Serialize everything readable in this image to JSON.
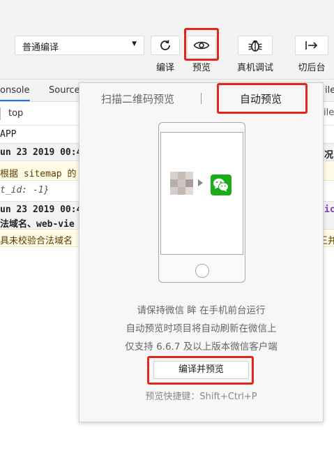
{
  "toolbar": {
    "compile_mode": "普通编译",
    "compile_label": "编译",
    "preview_label": "预览",
    "remote_debug_label": "真机调试",
    "background_label": "切后台"
  },
  "devtools": {
    "tabs": [
      "onsole",
      "Source"
    ],
    "context": "top",
    "right_fragment_tab": "ilev",
    "lines": [
      {
        "text": "APP",
        "style": "plain"
      },
      {
        "text": "un 23 2019 00:4",
        "right": "况",
        "style": "bold"
      },
      {
        "text": "根据 sitemap 的",
        "style": "warn"
      },
      {
        "text": "t_id: -1}",
        "style": "italic"
      },
      {
        "text": "un 23 2019 00:4",
        "right": "ic",
        "style": "bold"
      },
      {
        "text": "法域名、web-vie",
        "style": "bold2"
      },
      {
        "text": "具未校验合法域名",
        "right": "王并",
        "style": "warn"
      }
    ]
  },
  "popup": {
    "tab_qr": "扫描二维码预览",
    "tab_auto": "自动预览",
    "info_lines": [
      "请保持微信 眸 在手机前台运行",
      "自动预览时项目将自动刷新在微信上",
      "仅支持 6.6.7 及以上版本微信客户端"
    ],
    "compile_preview_button": "编译并预览",
    "shortcut": "预览快捷键：Shift+Ctrl+P"
  },
  "colors": {
    "highlight": "#e3261c",
    "wechat_green": "#1aad19"
  },
  "icons": [
    "refresh-icon",
    "eye-icon",
    "bug-icon",
    "switch-background-icon",
    "wechat-icon",
    "dropdown-caret-icon"
  ]
}
